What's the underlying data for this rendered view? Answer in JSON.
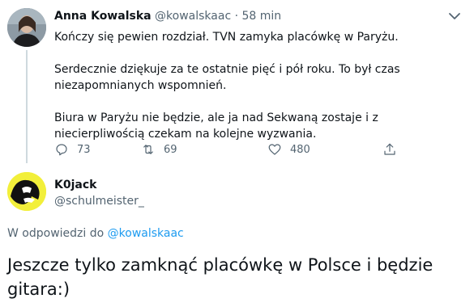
{
  "tweet": {
    "author_name": "Anna Kowalska",
    "author_handle": "@kowalskaac",
    "separator": "·",
    "time": "58 min",
    "paragraphs": [
      "Kończy się pewien rozdział. TVN zamyka placówkę w Paryżu.",
      "Serdecznie dziękuje za te ostatnie pięć i pół roku. To był czas niezapomnianych wspomnień.",
      "Biura w Paryżu nie będzie, ale ja nad Sekwaną zostaje i z niecierpliwością czekam na kolejne wyzwania."
    ],
    "actions": {
      "reply_count": "73",
      "retweet_count": "69",
      "like_count": "480"
    }
  },
  "reply": {
    "author_name": "K0jack",
    "author_handle": "@schulmeister_",
    "replying_prefix": "W odpowiedzi do",
    "replying_handle": "@kowalskaac",
    "text": "Jeszcze tylko zamknąć placówkę w Polsce i będzie gitara:)"
  },
  "colors": {
    "link": "#1d9bf0",
    "muted": "#536471",
    "text": "#0f1419"
  },
  "icons": [
    "chevron-down-icon",
    "reply-icon",
    "retweet-icon",
    "like-icon",
    "share-icon"
  ]
}
